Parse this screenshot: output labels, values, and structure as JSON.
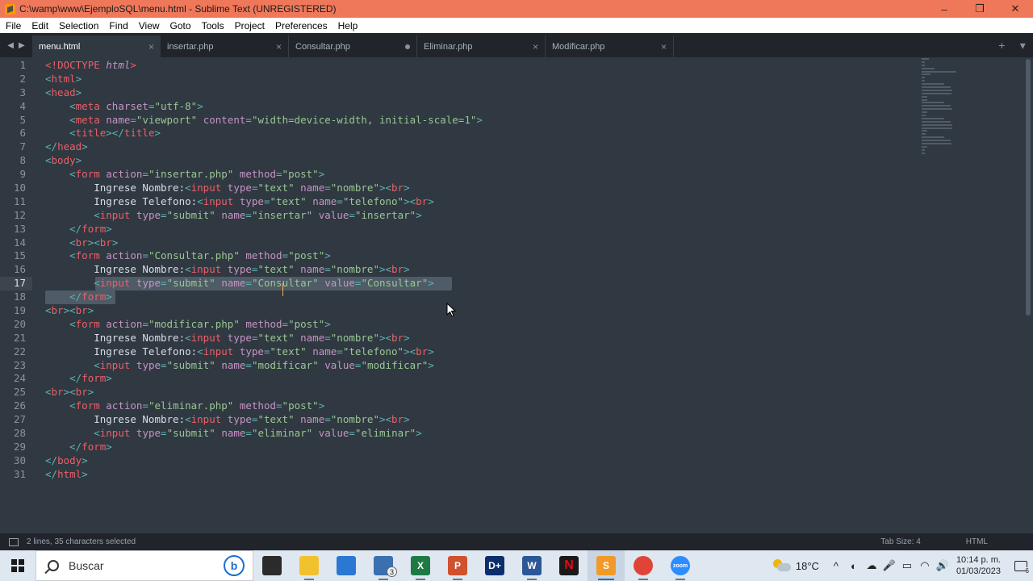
{
  "window": {
    "title": "C:\\wamp\\www\\EjemploSQL\\menu.html - Sublime Text (UNREGISTERED)",
    "controls": [
      "–",
      "❐",
      "✕"
    ]
  },
  "menu": [
    "File",
    "Edit",
    "Selection",
    "Find",
    "View",
    "Goto",
    "Tools",
    "Project",
    "Preferences",
    "Help"
  ],
  "tabs": [
    {
      "label": "menu.html",
      "active": true,
      "marker": "×"
    },
    {
      "label": "insertar.php",
      "active": false,
      "marker": "×"
    },
    {
      "label": "Consultar.php",
      "active": false,
      "marker": "dot"
    },
    {
      "label": "Eliminar.php",
      "active": false,
      "marker": "×"
    },
    {
      "label": "Modificar.php",
      "active": false,
      "marker": "×"
    }
  ],
  "tab_actions": {
    "new": "+",
    "more": "▾"
  },
  "editor": {
    "current_line": 17,
    "lines": [
      [
        [
          "t",
          "<!"
        ],
        [
          "t",
          "DOCTYPE"
        ],
        [
          "tx",
          " "
        ],
        [
          "a it",
          "html"
        ],
        [
          "t",
          ">"
        ]
      ],
      [
        [
          "p",
          "<"
        ],
        [
          "t",
          "html"
        ],
        [
          "p",
          ">"
        ]
      ],
      [
        [
          "p",
          "<"
        ],
        [
          "t",
          "head"
        ],
        [
          "p",
          ">"
        ]
      ],
      [
        [
          "tx",
          "    "
        ],
        [
          "p",
          "<"
        ],
        [
          "t",
          "meta"
        ],
        [
          "tx",
          " "
        ],
        [
          "a",
          "charset"
        ],
        [
          "p",
          "="
        ],
        [
          "s",
          "\"utf-8\""
        ],
        [
          "p",
          ">"
        ]
      ],
      [
        [
          "tx",
          "    "
        ],
        [
          "p",
          "<"
        ],
        [
          "t",
          "meta"
        ],
        [
          "tx",
          " "
        ],
        [
          "a",
          "name"
        ],
        [
          "p",
          "="
        ],
        [
          "s",
          "\"viewport\""
        ],
        [
          "tx",
          " "
        ],
        [
          "a",
          "content"
        ],
        [
          "p",
          "="
        ],
        [
          "s",
          "\"width=device-width, initial-scale=1\""
        ],
        [
          "p",
          ">"
        ]
      ],
      [
        [
          "tx",
          "    "
        ],
        [
          "p",
          "<"
        ],
        [
          "t",
          "title"
        ],
        [
          "p",
          "></"
        ],
        [
          "t",
          "title"
        ],
        [
          "p",
          ">"
        ]
      ],
      [
        [
          "p",
          "</"
        ],
        [
          "t",
          "head"
        ],
        [
          "p",
          ">"
        ]
      ],
      [
        [
          "p",
          "<"
        ],
        [
          "t",
          "body"
        ],
        [
          "p",
          ">"
        ]
      ],
      [
        [
          "tx",
          "    "
        ],
        [
          "p",
          "<"
        ],
        [
          "t",
          "form"
        ],
        [
          "tx",
          " "
        ],
        [
          "a",
          "action"
        ],
        [
          "p",
          "="
        ],
        [
          "s",
          "\"insertar.php\""
        ],
        [
          "tx",
          " "
        ],
        [
          "a",
          "method"
        ],
        [
          "p",
          "="
        ],
        [
          "s",
          "\"post\""
        ],
        [
          "p",
          ">"
        ]
      ],
      [
        [
          "tx",
          "        Ingrese Nombre:"
        ],
        [
          "p",
          "<"
        ],
        [
          "t",
          "input"
        ],
        [
          "tx",
          " "
        ],
        [
          "a",
          "type"
        ],
        [
          "p",
          "="
        ],
        [
          "s",
          "\"text\""
        ],
        [
          "tx",
          " "
        ],
        [
          "a",
          "name"
        ],
        [
          "p",
          "="
        ],
        [
          "s",
          "\"nombre\""
        ],
        [
          "p",
          "><"
        ],
        [
          "t",
          "br"
        ],
        [
          "p",
          ">"
        ]
      ],
      [
        [
          "tx",
          "        Ingrese Telefono:"
        ],
        [
          "p",
          "<"
        ],
        [
          "t",
          "input"
        ],
        [
          "tx",
          " "
        ],
        [
          "a",
          "type"
        ],
        [
          "p",
          "="
        ],
        [
          "s",
          "\"text\""
        ],
        [
          "tx",
          " "
        ],
        [
          "a",
          "name"
        ],
        [
          "p",
          "="
        ],
        [
          "s",
          "\"telefono\""
        ],
        [
          "p",
          "><"
        ],
        [
          "t",
          "br"
        ],
        [
          "p",
          ">"
        ]
      ],
      [
        [
          "tx",
          "        "
        ],
        [
          "p",
          "<"
        ],
        [
          "t",
          "input"
        ],
        [
          "tx",
          " "
        ],
        [
          "a",
          "type"
        ],
        [
          "p",
          "="
        ],
        [
          "s",
          "\"submit\""
        ],
        [
          "tx",
          " "
        ],
        [
          "a",
          "name"
        ],
        [
          "p",
          "="
        ],
        [
          "s",
          "\"insertar\""
        ],
        [
          "tx",
          " "
        ],
        [
          "a",
          "value"
        ],
        [
          "p",
          "="
        ],
        [
          "s",
          "\"insertar\""
        ],
        [
          "p",
          ">"
        ]
      ],
      [
        [
          "tx",
          "    "
        ],
        [
          "p",
          "</"
        ],
        [
          "t",
          "form"
        ],
        [
          "p",
          ">"
        ]
      ],
      [
        [
          "tx",
          "    "
        ],
        [
          "p",
          "<"
        ],
        [
          "t",
          "br"
        ],
        [
          "p",
          "><"
        ],
        [
          "t",
          "br"
        ],
        [
          "p",
          ">"
        ]
      ],
      [
        [
          "tx",
          "    "
        ],
        [
          "p",
          "<"
        ],
        [
          "t",
          "form"
        ],
        [
          "tx",
          " "
        ],
        [
          "a",
          "action"
        ],
        [
          "p",
          "="
        ],
        [
          "s",
          "\"Consultar.php\""
        ],
        [
          "tx",
          " "
        ],
        [
          "a",
          "method"
        ],
        [
          "p",
          "="
        ],
        [
          "s",
          "\"post\""
        ],
        [
          "p",
          ">"
        ]
      ],
      [
        [
          "tx",
          "        Ingrese Nombre:"
        ],
        [
          "p",
          "<"
        ],
        [
          "t",
          "input"
        ],
        [
          "tx",
          " "
        ],
        [
          "a",
          "type"
        ],
        [
          "p",
          "="
        ],
        [
          "s",
          "\"text\""
        ],
        [
          "tx",
          " "
        ],
        [
          "a",
          "name"
        ],
        [
          "p",
          "="
        ],
        [
          "s",
          "\"nombre\""
        ],
        [
          "p",
          "><"
        ],
        [
          "t",
          "br"
        ],
        [
          "p",
          ">"
        ]
      ],
      [
        [
          "tx",
          "        "
        ],
        [
          "p",
          "<"
        ],
        [
          "t",
          "input"
        ],
        [
          "tx",
          " "
        ],
        [
          "a",
          "type"
        ],
        [
          "p",
          "="
        ],
        [
          "s",
          "\"submit\""
        ],
        [
          "tx",
          " "
        ],
        [
          "a",
          "name"
        ],
        [
          "p",
          "="
        ],
        [
          "s",
          "\"Consultar\""
        ],
        [
          "tx",
          " "
        ],
        [
          "a",
          "value"
        ],
        [
          "p",
          "="
        ],
        [
          "s",
          "\"Consultar\""
        ],
        [
          "p",
          ">"
        ]
      ],
      [
        [
          "tx",
          "    "
        ],
        [
          "p",
          "</"
        ],
        [
          "t",
          "form"
        ],
        [
          "p",
          ">"
        ]
      ],
      [
        [
          "p",
          "<"
        ],
        [
          "t",
          "br"
        ],
        [
          "p",
          "><"
        ],
        [
          "t",
          "br"
        ],
        [
          "p",
          ">"
        ]
      ],
      [
        [
          "tx",
          "    "
        ],
        [
          "p",
          "<"
        ],
        [
          "t",
          "form"
        ],
        [
          "tx",
          " "
        ],
        [
          "a",
          "action"
        ],
        [
          "p",
          "="
        ],
        [
          "s",
          "\"modificar.php\""
        ],
        [
          "tx",
          " "
        ],
        [
          "a",
          "method"
        ],
        [
          "p",
          "="
        ],
        [
          "s",
          "\"post\""
        ],
        [
          "p",
          ">"
        ]
      ],
      [
        [
          "tx",
          "        Ingrese Nombre:"
        ],
        [
          "p",
          "<"
        ],
        [
          "t",
          "input"
        ],
        [
          "tx",
          " "
        ],
        [
          "a",
          "type"
        ],
        [
          "p",
          "="
        ],
        [
          "s",
          "\"text\""
        ],
        [
          "tx",
          " "
        ],
        [
          "a",
          "name"
        ],
        [
          "p",
          "="
        ],
        [
          "s",
          "\"nombre\""
        ],
        [
          "p",
          "><"
        ],
        [
          "t",
          "br"
        ],
        [
          "p",
          ">"
        ]
      ],
      [
        [
          "tx",
          "        Ingrese Telefono:"
        ],
        [
          "p",
          "<"
        ],
        [
          "t",
          "input"
        ],
        [
          "tx",
          " "
        ],
        [
          "a",
          "type"
        ],
        [
          "p",
          "="
        ],
        [
          "s",
          "\"text\""
        ],
        [
          "tx",
          " "
        ],
        [
          "a",
          "name"
        ],
        [
          "p",
          "="
        ],
        [
          "s",
          "\"telefono\""
        ],
        [
          "p",
          "><"
        ],
        [
          "t",
          "br"
        ],
        [
          "p",
          ">"
        ]
      ],
      [
        [
          "tx",
          "        "
        ],
        [
          "p",
          "<"
        ],
        [
          "t",
          "input"
        ],
        [
          "tx",
          " "
        ],
        [
          "a",
          "type"
        ],
        [
          "p",
          "="
        ],
        [
          "s",
          "\"submit\""
        ],
        [
          "tx",
          " "
        ],
        [
          "a",
          "name"
        ],
        [
          "p",
          "="
        ],
        [
          "s",
          "\"modificar\""
        ],
        [
          "tx",
          " "
        ],
        [
          "a",
          "value"
        ],
        [
          "p",
          "="
        ],
        [
          "s",
          "\"modificar\""
        ],
        [
          "p",
          ">"
        ]
      ],
      [
        [
          "tx",
          "    "
        ],
        [
          "p",
          "</"
        ],
        [
          "t",
          "form"
        ],
        [
          "p",
          ">"
        ]
      ],
      [
        [
          "p",
          "<"
        ],
        [
          "t",
          "br"
        ],
        [
          "p",
          "><"
        ],
        [
          "t",
          "br"
        ],
        [
          "p",
          ">"
        ]
      ],
      [
        [
          "tx",
          "    "
        ],
        [
          "p",
          "<"
        ],
        [
          "t",
          "form"
        ],
        [
          "tx",
          " "
        ],
        [
          "a",
          "action"
        ],
        [
          "p",
          "="
        ],
        [
          "s",
          "\"eliminar.php\""
        ],
        [
          "tx",
          " "
        ],
        [
          "a",
          "method"
        ],
        [
          "p",
          "="
        ],
        [
          "s",
          "\"post\""
        ],
        [
          "p",
          ">"
        ]
      ],
      [
        [
          "tx",
          "        Ingrese Nombre:"
        ],
        [
          "p",
          "<"
        ],
        [
          "t",
          "input"
        ],
        [
          "tx",
          " "
        ],
        [
          "a",
          "type"
        ],
        [
          "p",
          "="
        ],
        [
          "s",
          "\"text\""
        ],
        [
          "tx",
          " "
        ],
        [
          "a",
          "name"
        ],
        [
          "p",
          "="
        ],
        [
          "s",
          "\"nombre\""
        ],
        [
          "p",
          "><"
        ],
        [
          "t",
          "br"
        ],
        [
          "p",
          ">"
        ]
      ],
      [
        [
          "tx",
          "        "
        ],
        [
          "p",
          "<"
        ],
        [
          "t",
          "input"
        ],
        [
          "tx",
          " "
        ],
        [
          "a",
          "type"
        ],
        [
          "p",
          "="
        ],
        [
          "s",
          "\"submit\""
        ],
        [
          "tx",
          " "
        ],
        [
          "a",
          "name"
        ],
        [
          "p",
          "="
        ],
        [
          "s",
          "\"eliminar\""
        ],
        [
          "tx",
          " "
        ],
        [
          "a",
          "value"
        ],
        [
          "p",
          "="
        ],
        [
          "s",
          "\"eliminar\""
        ],
        [
          "p",
          ">"
        ]
      ],
      [
        [
          "tx",
          "    "
        ],
        [
          "p",
          "</"
        ],
        [
          "t",
          "form"
        ],
        [
          "p",
          ">"
        ]
      ],
      [
        [
          "p",
          "</"
        ],
        [
          "t",
          "body"
        ],
        [
          "p",
          ">"
        ]
      ],
      [
        [
          "p",
          "</"
        ],
        [
          "t",
          "html"
        ],
        [
          "p",
          ">"
        ]
      ]
    ]
  },
  "status": {
    "selection": "2 lines, 35 characters selected",
    "tab_size": "Tab Size: 4",
    "syntax": "HTML"
  },
  "taskbar": {
    "search_placeholder": "Buscar",
    "bing": "b",
    "apps": [
      {
        "name": "task-view",
        "label": "",
        "color": "#2b2b2b"
      },
      {
        "name": "file-explorer",
        "label": "",
        "color": "#f2c12e"
      },
      {
        "name": "microsoft-store",
        "label": "",
        "color": "#2a78d4"
      },
      {
        "name": "mail",
        "label": "",
        "color": "#3a6fb0",
        "badge": "3"
      },
      {
        "name": "excel",
        "label": "X",
        "color": "#1d7a45"
      },
      {
        "name": "powerpoint",
        "label": "P",
        "color": "#d0512f"
      },
      {
        "name": "disney-plus",
        "label": "D+",
        "color": "#0c2f6b"
      },
      {
        "name": "word",
        "label": "W",
        "color": "#2b5797"
      },
      {
        "name": "netflix",
        "label": "N",
        "color": "#1a1a1a"
      },
      {
        "name": "sublime-text",
        "label": "S",
        "color": "#f29a27"
      },
      {
        "name": "chrome",
        "label": "",
        "color": "#e04436"
      },
      {
        "name": "zoom",
        "label": "zoom",
        "color": "#2d8cff"
      }
    ],
    "weather": "18°C",
    "tray_icons": [
      "^",
      "◐",
      "☁",
      "🎤",
      "▭",
      "◠",
      "🔊"
    ],
    "time": "10:14 p. m.",
    "date": "01/03/2023",
    "notifications": "6"
  }
}
